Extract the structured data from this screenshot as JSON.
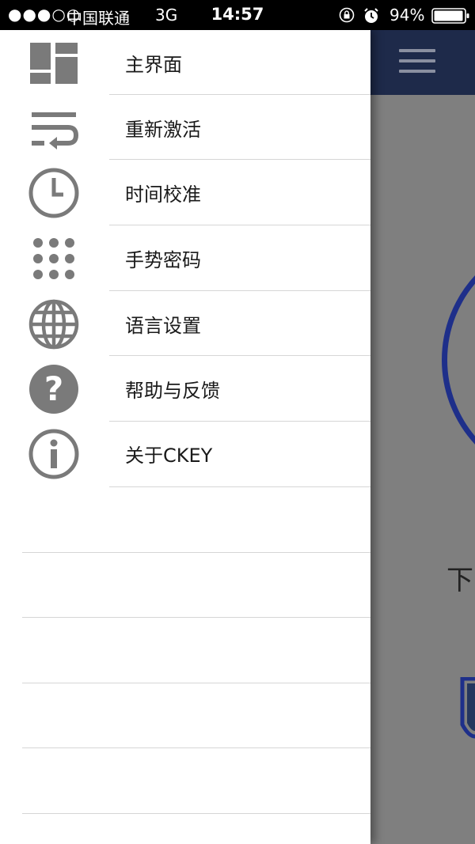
{
  "status_bar": {
    "signal": "●●●○○",
    "carrier": "中国联通",
    "network": "3G",
    "time": "14:57",
    "battery_percent": "94%"
  },
  "drawer": {
    "items": [
      {
        "label": "主界面",
        "icon": "dashboard-icon"
      },
      {
        "label": "重新激活",
        "icon": "wrap-return-icon"
      },
      {
        "label": "时间校准",
        "icon": "clock-icon"
      },
      {
        "label": "手势密码",
        "icon": "gesture-grid-icon"
      },
      {
        "label": "语言设置",
        "icon": "globe-icon"
      },
      {
        "label": "帮助与反馈",
        "icon": "help-icon"
      },
      {
        "label": "关于CKEY",
        "icon": "info-icon"
      }
    ]
  },
  "main_app": {
    "partial_text": "下",
    "header_color": "#1e2a4a",
    "accent_color": "#1e2f8a"
  }
}
